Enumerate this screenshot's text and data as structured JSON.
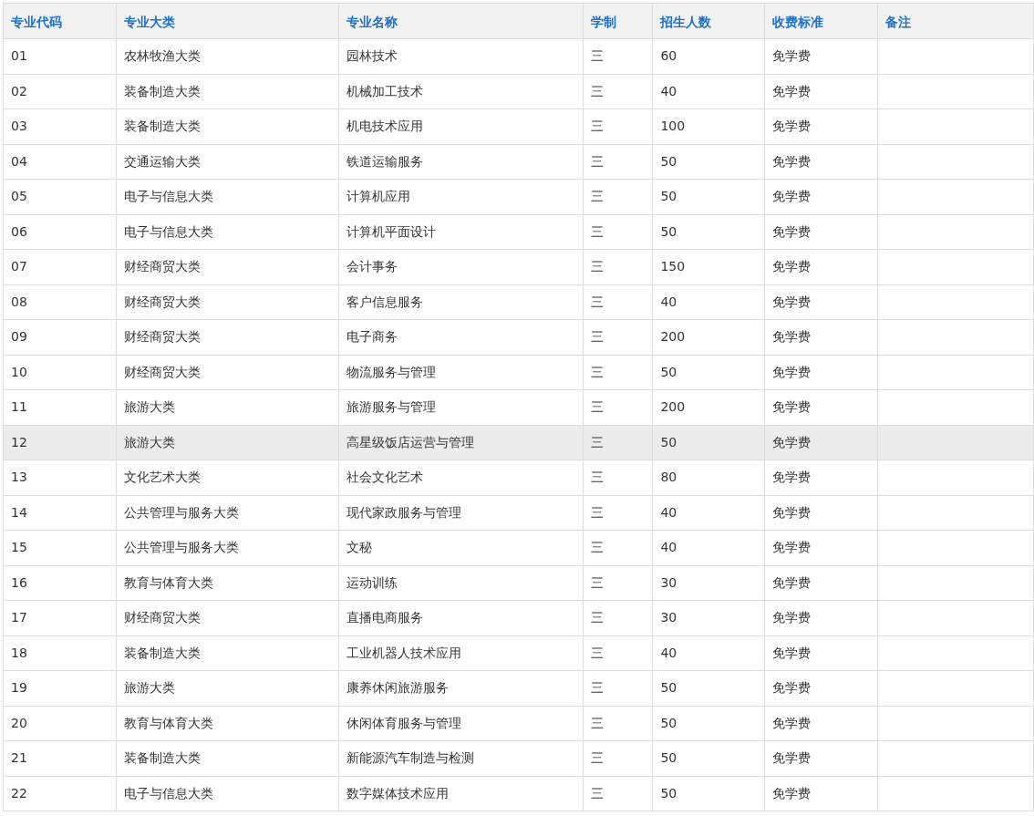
{
  "table": {
    "columns": [
      "专业代码",
      "专业大类",
      "专业名称",
      "学制",
      "招生人数",
      "收费标准",
      "备注"
    ],
    "rows": [
      {
        "code": "01",
        "category": "农林牧渔大类",
        "name": "园林技术",
        "duration": "三",
        "enrollment": "60",
        "fee": "免学费",
        "selected": false
      },
      {
        "code": "02",
        "category": "装备制造大类",
        "name": "机械加工技术",
        "duration": "三",
        "enrollment": "40",
        "fee": "免学费",
        "selected": false
      },
      {
        "code": "03",
        "category": "装备制造大类",
        "name": "机电技术应用",
        "duration": "三",
        "enrollment": "100",
        "fee": "免学费",
        "selected": false
      },
      {
        "code": "04",
        "category": "交通运输大类",
        "name": "铁道运输服务",
        "duration": "三",
        "enrollment": "50",
        "fee": "免学费",
        "selected": false
      },
      {
        "code": "05",
        "category": "电子与信息大类",
        "name": "计算机应用",
        "duration": "三",
        "enrollment": "50",
        "fee": "免学费",
        "selected": false
      },
      {
        "code": "06",
        "category": "电子与信息大类",
        "name": "计算机平面设计",
        "duration": "三",
        "enrollment": "50",
        "fee": "免学费",
        "selected": false
      },
      {
        "code": "07",
        "category": "财经商贸大类",
        "name": "会计事务",
        "duration": "三",
        "enrollment": "150",
        "fee": "免学费",
        "selected": false
      },
      {
        "code": "08",
        "category": "财经商贸大类",
        "name": "客户信息服务",
        "duration": "三",
        "enrollment": "40",
        "fee": "免学费",
        "selected": false
      },
      {
        "code": "09",
        "category": "财经商贸大类",
        "name": "电子商务",
        "duration": "三",
        "enrollment": "200",
        "fee": "免学费",
        "selected": false
      },
      {
        "code": "10",
        "category": "财经商贸大类",
        "name": "物流服务与管理",
        "duration": "三",
        "enrollment": "50",
        "fee": "免学费",
        "selected": false
      },
      {
        "code": "11",
        "category": "旅游大类",
        "name": "旅游服务与管理",
        "duration": "三",
        "enrollment": "200",
        "fee": "免学费",
        "selected": false
      },
      {
        "code": "12",
        "category": "旅游大类",
        "name": "高星级饭店运营与管理",
        "duration": "三",
        "enrollment": "50",
        "fee": "免学费",
        "selected": true
      },
      {
        "code": "13",
        "category": "文化艺术大类",
        "name": "社会文化艺术",
        "duration": "三",
        "enrollment": "80",
        "fee": "免学费",
        "selected": false
      },
      {
        "code": "14",
        "category": "公共管理与服务大类",
        "name": "现代家政服务与管理",
        "duration": "三",
        "enrollment": "40",
        "fee": "免学费",
        "selected": false
      },
      {
        "code": "15",
        "category": "公共管理与服务大类",
        "name": "文秘",
        "duration": "三",
        "enrollment": "40",
        "fee": "免学费",
        "selected": false
      },
      {
        "code": "16",
        "category": "教育与体育大类",
        "name": "运动训练",
        "duration": "三",
        "enrollment": "30",
        "fee": "免学费",
        "selected": false
      },
      {
        "code": "17",
        "category": "财经商贸大类",
        "name": "直播电商服务",
        "duration": "三",
        "enrollment": "30",
        "fee": "免学费",
        "selected": false
      },
      {
        "code": "18",
        "category": "装备制造大类",
        "name": "工业机器人技术应用",
        "duration": "三",
        "enrollment": "40",
        "fee": "免学费",
        "selected": false
      },
      {
        "code": "19",
        "category": "旅游大类",
        "name": "康养休闲旅游服务",
        "duration": "三",
        "enrollment": "50",
        "fee": "免学费",
        "selected": false
      },
      {
        "code": "20",
        "category": "教育与体育大类",
        "name": "休闲体育服务与管理",
        "duration": "三",
        "enrollment": "50",
        "fee": "免学费",
        "selected": false
      },
      {
        "code": "21",
        "category": "装备制造大类",
        "name": "新能源汽车制造与检测",
        "duration": "三",
        "enrollment": "50",
        "fee": "免学费",
        "selected": false
      },
      {
        "code": "22",
        "category": "电子与信息大类",
        "name": "数字媒体技术应用",
        "duration": "三",
        "enrollment": "50",
        "fee": "免学费",
        "selected": false
      }
    ]
  }
}
